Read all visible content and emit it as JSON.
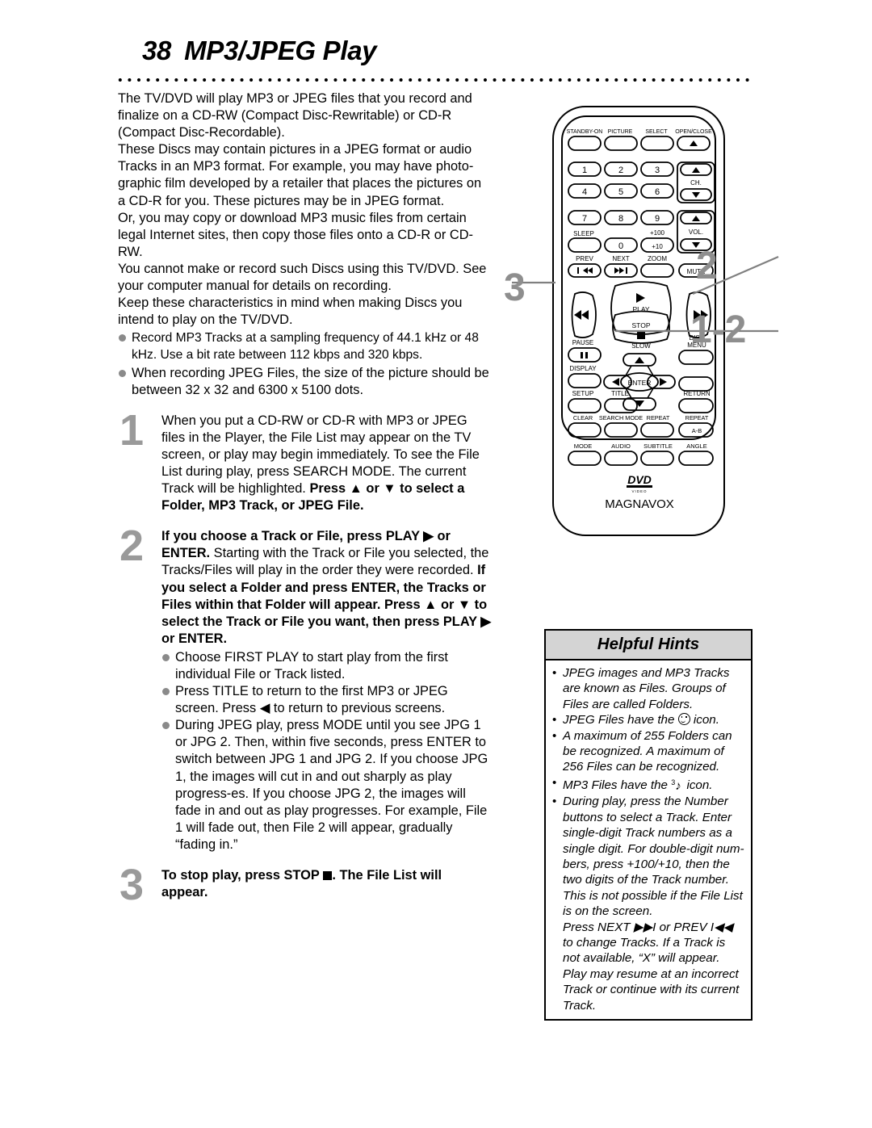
{
  "page": {
    "number": "38",
    "title": "MP3/JPEG Play"
  },
  "intro": {
    "paragraphs": [
      "The TV/DVD will play MP3 or JPEG files that you record and finalize on a CD-RW (Compact Disc-Rewritable) or CD-R (Compact Disc-Recordable).",
      "These Discs may contain pictures in a JPEG format or audio Tracks in an MP3 format. For example, you may have photo-graphic film developed by a retailer that places the pictures on a CD-R for you. These pictures may be in JPEG format.",
      "Or, you may copy or download MP3 music files from certain legal Internet sites, then copy those files onto a CD-R or CD-RW.",
      "You cannot make or record such Discs using this TV/DVD. See your computer manual for details on recording.",
      "Keep these characteristics in mind when making Discs you intend to play on the TV/DVD."
    ],
    "bullets": [
      "Record MP3 Tracks at a sampling frequency of 44.1 kHz or 48 kHz. Use a bit rate between 112 kbps and 320 kbps.",
      "When recording JPEG Files, the size of the picture should be between 32 x 32 and 6300 x 5100 dots."
    ]
  },
  "steps": [
    {
      "number": "1",
      "text_plain": "When you put a CD-RW or CD-R with MP3 or JPEG files in the Player, the File List may appear on the TV screen, or play may begin immediately. To see the File List during play, press SEARCH MODE. The current Track will be highlighted.",
      "text_bold": "Press ▲ or ▼ to select a Folder, MP3 Track, or JPEG File."
    },
    {
      "number": "2",
      "lead_bold": "If you choose a Track or File, press PLAY ▶ or ENTER.",
      "lead_plain": " Starting with the Track or File you selected, the Tracks/Files will play in the order they were recorded.",
      "bold_block": "If you select a Folder and press ENTER, the Tracks or Files within that Folder will appear. Press ▲ or ▼ to select the Track or File you want, then press PLAY ▶ or ENTER.",
      "bullets": [
        "Choose FIRST PLAY to start play from the first individual File or Track listed.",
        "Press TITLE to return to the first MP3 or JPEG screen. Press ◀ to return to previous screens.",
        "During JPEG play, press MODE until you see JPG 1 or JPG 2. Then, within five seconds, press ENTER to switch between JPG 1 and JPG 2. If you choose JPG 1, the images will cut in and out sharply as play progress-es. If you choose JPG 2, the images will fade in and out as play progresses. For example, File 1 will fade out, then File 2 will appear, gradually “fading in.”"
      ]
    },
    {
      "number": "3",
      "bold_part": "To stop play, press STOP",
      "after_icon": ". The File List will appear."
    }
  ],
  "callouts": [
    {
      "id": "callout-3",
      "label": "3"
    },
    {
      "id": "callout-2",
      "label": "2"
    },
    {
      "id": "callout-1-2",
      "label": "1-2"
    }
  ],
  "remote": {
    "brand": "MAGNAVOX",
    "logo": "DVD",
    "logo_sub": "VIDEO",
    "row1": [
      "STANDBY-ON",
      "PICTURE",
      "SELECT",
      "OPEN/CLOSE"
    ],
    "numbers": [
      "1",
      "2",
      "3",
      "4",
      "5",
      "6",
      "7",
      "8",
      "9",
      "0"
    ],
    "ch_label": "CH.",
    "vol_label": "VOL.",
    "sleep": "SLEEP",
    "plus100": "+100",
    "plus10": "+10",
    "prev": "PREV",
    "next": "NEXT",
    "zoom": "ZOOM",
    "mute": "MUTE",
    "play": "PLAY",
    "stop": "STOP",
    "pause": "PAUSE",
    "slow": "SLOW",
    "disc_menu_line1": "DISC",
    "disc_menu_line2": "MENU",
    "display": "DISPLAY",
    "enter": "ENTER",
    "setup": "SETUP",
    "title": "TITLE",
    "return": "RETURN",
    "clear": "CLEAR",
    "search_mode": "SEARCH MODE",
    "repeat": "REPEAT",
    "repeat2": "REPEAT",
    "ab": "A-B",
    "mode": "MODE",
    "audio": "AUDIO",
    "subtitle": "SUBTITLE",
    "angle": "ANGLE"
  },
  "helpful_hints": {
    "header": "Helpful Hints",
    "items": [
      {
        "pre": "JPEG images and MP3 Tracks are known as Files. Groups of Files are called Folders.",
        "icon": null,
        "post": ""
      },
      {
        "pre": "JPEG Files have the ",
        "icon": "smiley-icon",
        "post": " icon."
      },
      {
        "pre": "A maximum of 255 Folders can be recognized. A maximum of 256 Files can be recognized.",
        "icon": null,
        "post": ""
      },
      {
        "pre": "MP3 Files have the ",
        "icon": "mp3-note-icon",
        "post": " icon."
      },
      {
        "pre": "During play, press the Number buttons to select a Track. Enter single-digit Track numbers as a single digit. For double-digit num-bers, press +100/+10, then the two digits of the Track number. This is not possible if the File List is on the screen.",
        "icon": null,
        "post": ""
      }
    ],
    "closing": "Press NEXT ▶▶I or PREV I◀◀ to change Tracks. If a Track is not available, “X” will appear. Play may resume at an incorrect Track or continue with its current Track."
  }
}
